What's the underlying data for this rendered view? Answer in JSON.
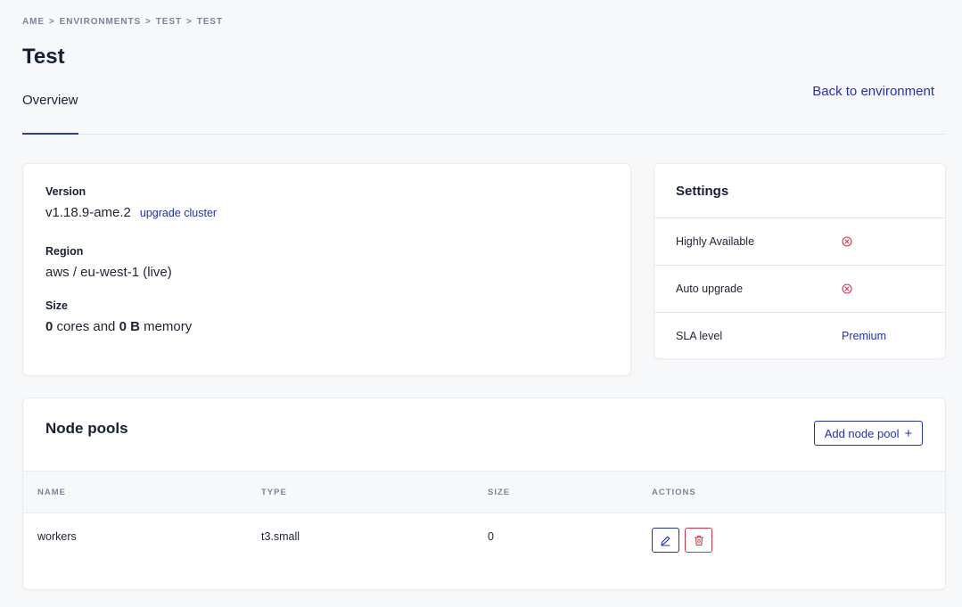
{
  "breadcrumb": [
    "AME",
    "ENVIRONMENTS",
    "TEST",
    "TEST"
  ],
  "breadcrumb_sep": ">",
  "page_title": "Test",
  "tabs": [
    {
      "label": "Overview",
      "active": true
    }
  ],
  "back_link": "Back to environment",
  "cluster": {
    "version_label": "Version",
    "version_value": "v1.18.9-ame.2",
    "upgrade_link": "upgrade cluster",
    "region_label": "Region",
    "region_value": "aws / eu-west-1 (live)",
    "size_label": "Size",
    "size_cores": "0",
    "size_cores_text": " cores and ",
    "size_memory": "0 B",
    "size_memory_text": " memory"
  },
  "settings": {
    "title": "Settings",
    "rows": [
      {
        "label": "Highly Available",
        "icon": "x-circle-icon",
        "enabled": false
      },
      {
        "label": "Auto upgrade",
        "icon": "x-circle-icon",
        "enabled": false
      },
      {
        "label": "SLA level",
        "value": "Premium"
      }
    ]
  },
  "node_pools": {
    "title": "Node pools",
    "add_button": "Add node pool",
    "add_icon": "+",
    "columns": [
      "NAME",
      "TYPE",
      "SIZE",
      "ACTIONS"
    ],
    "rows": [
      {
        "name": "workers",
        "type": "t3.small",
        "size": "0"
      }
    ]
  },
  "colors": {
    "accent": "#2332b3",
    "danger": "#d6344a",
    "muted": "#7b8597"
  }
}
